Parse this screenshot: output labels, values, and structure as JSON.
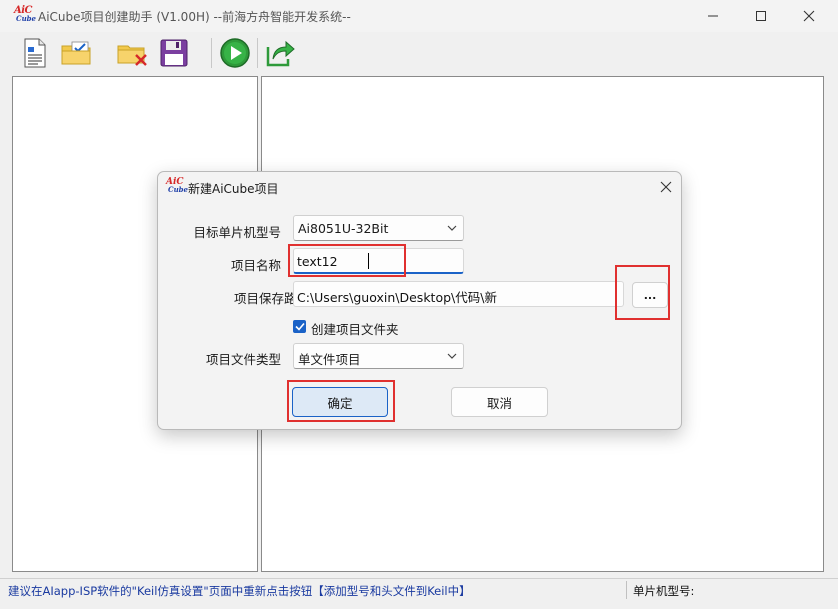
{
  "window": {
    "title": "AiCube项目创建助手 (V1.00H) --前海方舟智能开发系统--",
    "logo_top": "AiC",
    "logo_bottom": "Cube"
  },
  "toolbar": {
    "items": [
      {
        "name": "new-document-icon"
      },
      {
        "name": "open-folder-icon",
        "has_dropdown": true
      },
      {
        "name": "delete-folder-icon"
      },
      {
        "name": "save-disk-icon",
        "has_dropdown": true
      },
      {
        "name": "run-play-icon"
      },
      {
        "name": "export-share-icon"
      }
    ]
  },
  "dialog": {
    "title": "新建AiCube项目",
    "logo_top": "AiC",
    "logo_bottom": "Cube",
    "mcu_label": "目标单片机型号",
    "mcu_value": "Ai8051U-32Bit",
    "name_label": "项目名称",
    "name_value": "text12",
    "path_label": "项目保存路径",
    "path_value": "C:\\Users\\guoxin\\Desktop\\代码\\新",
    "browse_label": "...",
    "create_folder_label": "创建项目文件夹",
    "create_folder_checked": true,
    "type_label": "项目文件类型",
    "type_value": "单文件项目",
    "ok_label": "确定",
    "cancel_label": "取消"
  },
  "statusbar": {
    "message": "建议在AIapp-ISP软件的\"Keil仿真设置\"页面中重新点击按钮【添加型号和头文件到Keil中】",
    "model_label": "单片机型号:"
  },
  "colors": {
    "accent": "#1a62c7",
    "highlight": "#e0302f",
    "status_text": "#1a3aa0"
  }
}
